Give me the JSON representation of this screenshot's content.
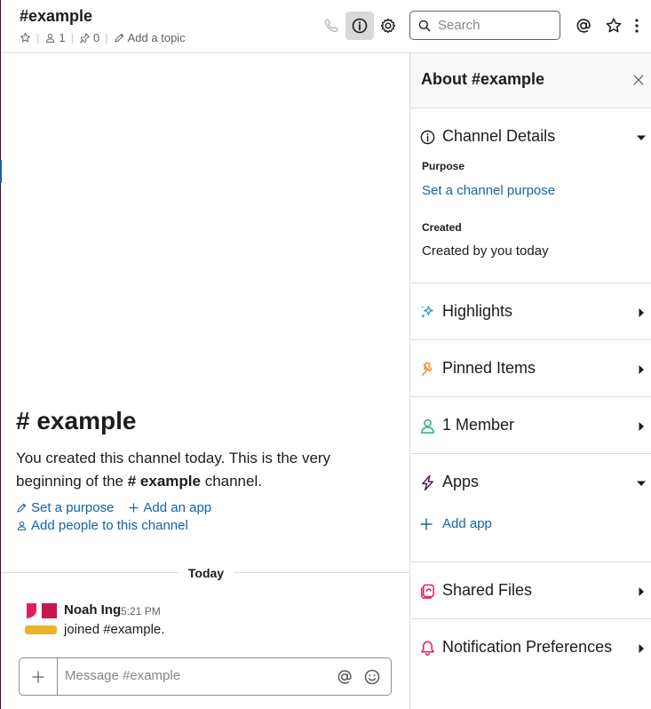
{
  "header": {
    "channel_name": "#example",
    "member_count": "1",
    "pinned_count": "0",
    "add_topic": "Add a topic",
    "search_placeholder": "Search"
  },
  "intro": {
    "title": "example",
    "hash": "#",
    "text_before": "You created this channel today. This is the very beginning of the ",
    "channel_bold": "example",
    "text_after": " channel.",
    "set_purpose": "Set a purpose",
    "add_app": "Add an app",
    "add_people": "Add people to this channel"
  },
  "timeline": {
    "date_divider": "Today",
    "messages": [
      {
        "author": "Noah Ing",
        "time": "5:21 PM",
        "text": "joined #example."
      }
    ]
  },
  "composer": {
    "placeholder": "Message #example"
  },
  "details": {
    "title": "About #example",
    "sections": {
      "channel_details": {
        "label": "Channel Details",
        "purpose_label": "Purpose",
        "purpose_link": "Set a channel purpose",
        "created_label": "Created",
        "created_value": "Created by you today"
      },
      "highlights": {
        "label": "Highlights"
      },
      "pinned": {
        "label": "Pinned Items"
      },
      "members": {
        "label": "1 Member"
      },
      "apps": {
        "label": "Apps",
        "add_app": "Add app"
      },
      "shared_files": {
        "label": "Shared Files"
      },
      "notifications": {
        "label": "Notification Preferences"
      }
    }
  },
  "colors": {
    "link": "#1264a3",
    "text": "#1d1c1d",
    "muted": "#616061",
    "highlights_icon": "#1d9bd1",
    "pinned_icon": "#e8912d",
    "member_icon": "#2bac76",
    "apps_icon": "#4a154b",
    "files_icon": "#e01e5a",
    "notif_icon": "#e01e5a"
  }
}
